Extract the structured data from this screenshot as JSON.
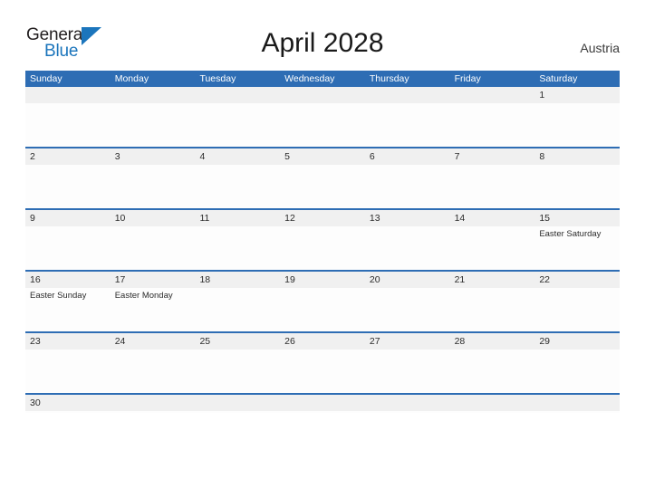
{
  "logo": {
    "word_one": "General",
    "word_two": "Blue",
    "triangle_icon": "triangle-icon",
    "dark_color": "#231f20",
    "blue_color": "#1b75bc"
  },
  "header": {
    "title": "April 2028",
    "country": "Austria"
  },
  "theme": {
    "header_blue": "#2e6db4",
    "day_band_gray": "#f0f0f0",
    "page_background": "#ffffff",
    "cell_background": "#fdfdfd"
  },
  "calendar": {
    "weekdays": [
      "Sunday",
      "Monday",
      "Tuesday",
      "Wednesday",
      "Thursday",
      "Friday",
      "Saturday"
    ],
    "weeks": [
      {
        "days": [
          {
            "date": "",
            "events": []
          },
          {
            "date": "",
            "events": []
          },
          {
            "date": "",
            "events": []
          },
          {
            "date": "",
            "events": []
          },
          {
            "date": "",
            "events": []
          },
          {
            "date": "",
            "events": []
          },
          {
            "date": "1",
            "events": []
          }
        ]
      },
      {
        "days": [
          {
            "date": "2",
            "events": []
          },
          {
            "date": "3",
            "events": []
          },
          {
            "date": "4",
            "events": []
          },
          {
            "date": "5",
            "events": []
          },
          {
            "date": "6",
            "events": []
          },
          {
            "date": "7",
            "events": []
          },
          {
            "date": "8",
            "events": []
          }
        ]
      },
      {
        "days": [
          {
            "date": "9",
            "events": []
          },
          {
            "date": "10",
            "events": []
          },
          {
            "date": "11",
            "events": []
          },
          {
            "date": "12",
            "events": []
          },
          {
            "date": "13",
            "events": []
          },
          {
            "date": "14",
            "events": []
          },
          {
            "date": "15",
            "events": [
              "Easter Saturday"
            ]
          }
        ]
      },
      {
        "days": [
          {
            "date": "16",
            "events": [
              "Easter Sunday"
            ]
          },
          {
            "date": "17",
            "events": [
              "Easter Monday"
            ]
          },
          {
            "date": "18",
            "events": []
          },
          {
            "date": "19",
            "events": []
          },
          {
            "date": "20",
            "events": []
          },
          {
            "date": "21",
            "events": []
          },
          {
            "date": "22",
            "events": []
          }
        ]
      },
      {
        "days": [
          {
            "date": "23",
            "events": []
          },
          {
            "date": "24",
            "events": []
          },
          {
            "date": "25",
            "events": []
          },
          {
            "date": "26",
            "events": []
          },
          {
            "date": "27",
            "events": []
          },
          {
            "date": "28",
            "events": []
          },
          {
            "date": "29",
            "events": []
          }
        ]
      },
      {
        "days": [
          {
            "date": "30",
            "events": []
          },
          {
            "date": "",
            "events": []
          },
          {
            "date": "",
            "events": []
          },
          {
            "date": "",
            "events": []
          },
          {
            "date": "",
            "events": []
          },
          {
            "date": "",
            "events": []
          },
          {
            "date": "",
            "events": []
          }
        ]
      }
    ]
  }
}
